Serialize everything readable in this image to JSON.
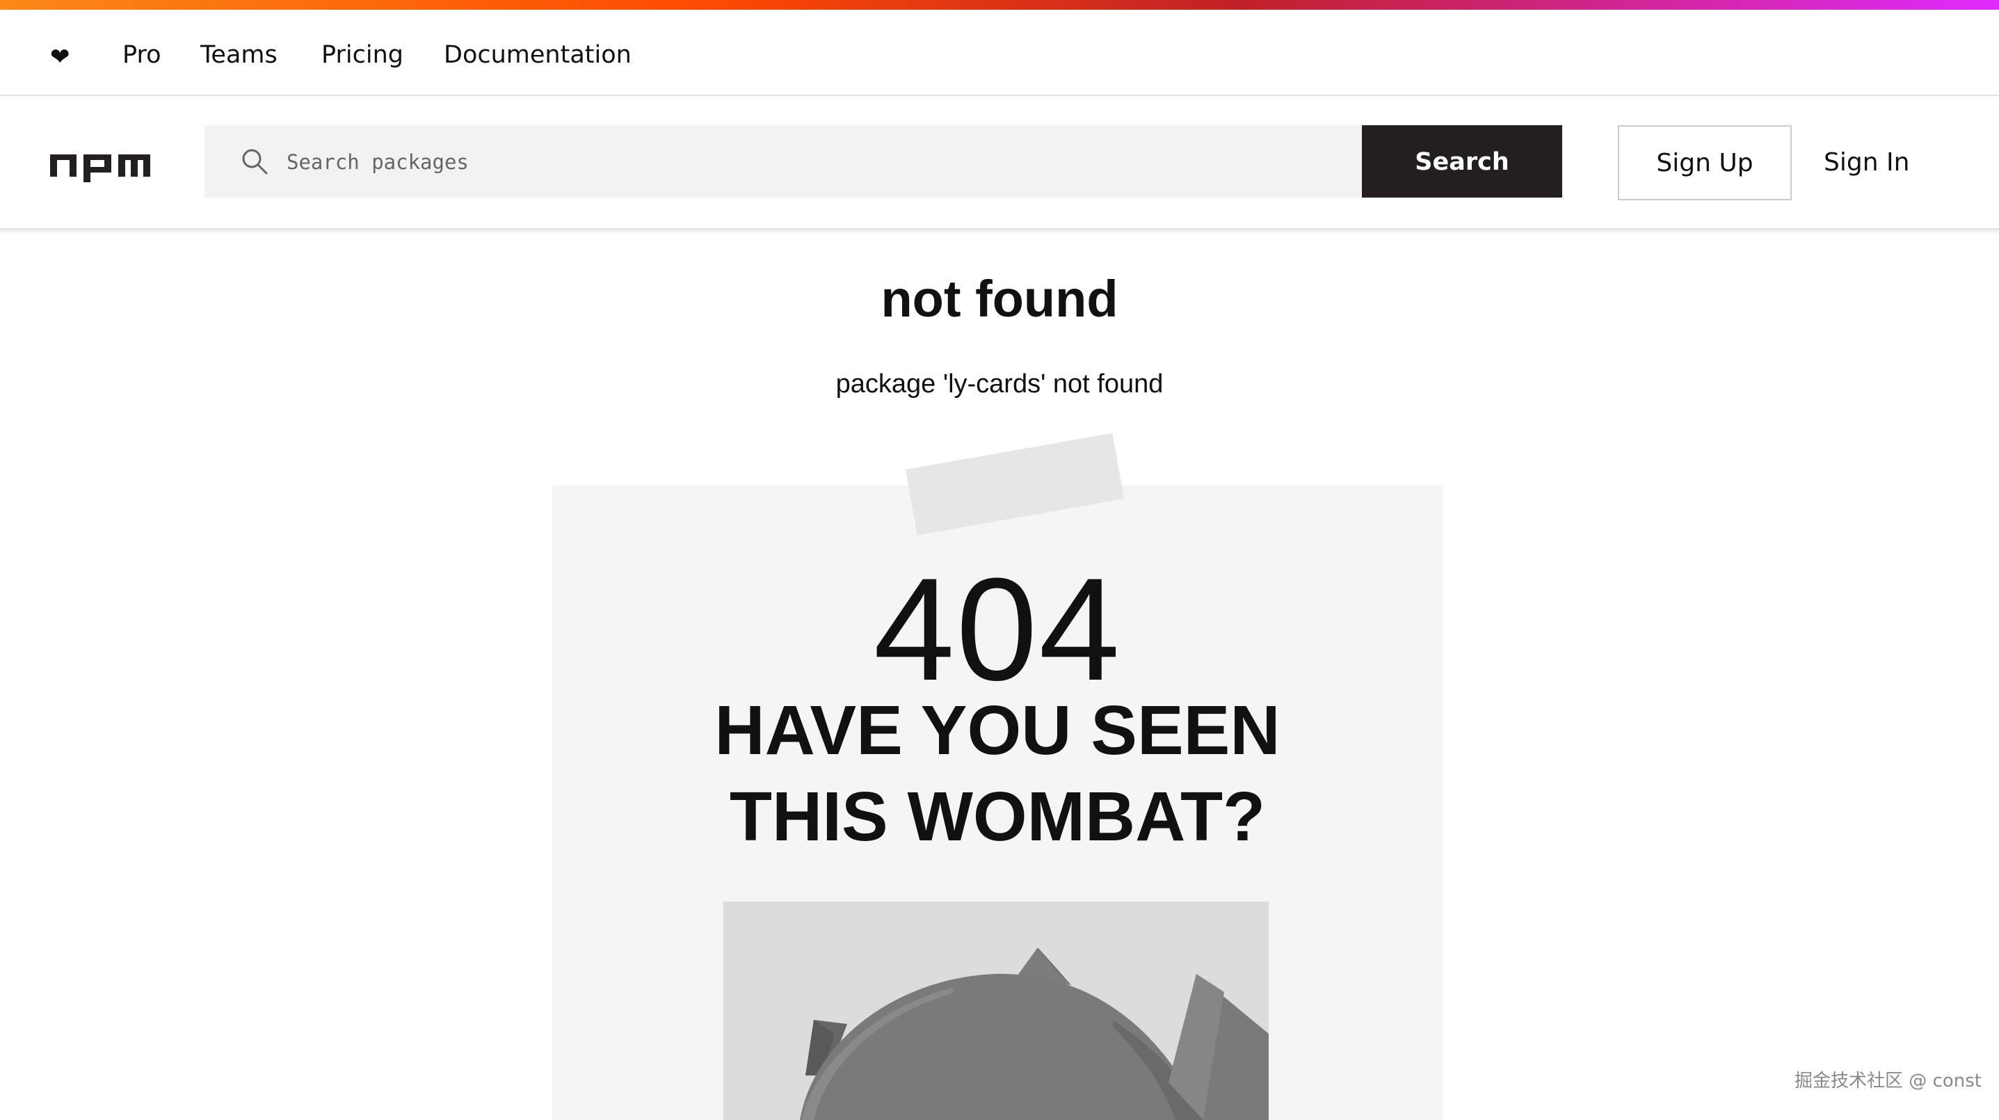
{
  "colors": {
    "gradient": [
      "#fb8817",
      "#ff4b01",
      "#c12127",
      "#e02aff"
    ],
    "search_button_bg": "#231f20",
    "poster_bg": "#f5f5f5",
    "wombat_gray": "#7a7a7a"
  },
  "top_nav": {
    "heart_icon": "❤",
    "links": [
      "Pro",
      "Teams",
      "Pricing",
      "Documentation"
    ]
  },
  "header": {
    "logo_alt": "npm",
    "search": {
      "placeholder": "Search packages",
      "value": "",
      "button_label": "Search"
    },
    "sign_up_label": "Sign Up",
    "sign_in_label": "Sign In"
  },
  "main": {
    "title": "not found",
    "message": "package 'ly-cards' not found",
    "poster": {
      "code": "404",
      "headline_line1": "HAVE YOU SEEN",
      "headline_line2": "THIS WOMBAT?"
    }
  },
  "watermark": "掘金技术社区 @ const"
}
